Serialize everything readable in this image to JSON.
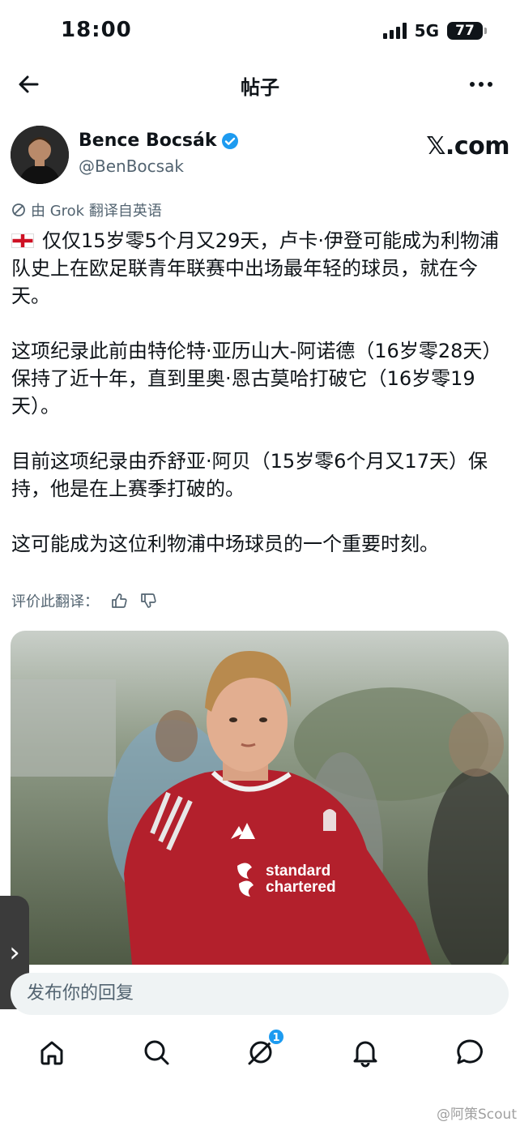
{
  "status_bar": {
    "time": "18:00",
    "network": "5G",
    "battery": "77"
  },
  "nav": {
    "title": "帖子"
  },
  "post": {
    "author_name": "Bence Bocsák",
    "author_handle": "@BenBocsak",
    "source_label": "𝕏.com",
    "translation_note": "由 Grok 翻译自英语",
    "paragraphs": [
      "仅仅15岁零5个月又29天，卢卡·伊登可能成为利物浦队史上在欧足联青年联赛中出场最年轻的球员，就在今天。",
      "这项纪录此前由特伦特·亚历山大-阿诺德（16岁零28天）保持了近十年，直到里奥·恩古莫哈打破它（16岁零19天）。",
      "目前这项纪录由乔舒亚·阿贝（15岁零6个月又17天）保持，他是在上赛季打破的。",
      "这可能成为这位利物浦中场球员的一个重要时刻。"
    ],
    "rate_label": "评价此翻译：",
    "photo_jersey_text_1": "standard",
    "photo_jersey_text_2": "chartered"
  },
  "reply": {
    "placeholder": "发布你的回复"
  },
  "tabbar": {
    "notifications_badge": "1"
  },
  "watermark": "@阿策Scout",
  "colors": {
    "accent": "#1d9bf0",
    "text": "#0f1419",
    "muted": "#536471",
    "jersey": "#b3202c"
  }
}
